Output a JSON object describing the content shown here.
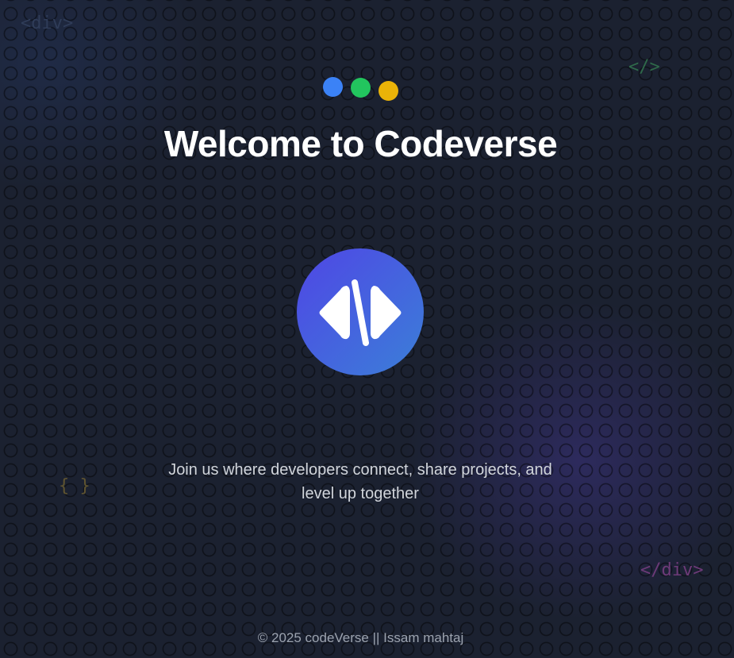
{
  "decorations": {
    "div_open": "<div>",
    "slash_tag": "</>",
    "braces": "{ }",
    "div_close": "</div>"
  },
  "header": {
    "dots": [
      {
        "name": "blue-dot",
        "color": "#3b82f6"
      },
      {
        "name": "green-dot",
        "color": "#22c55e"
      },
      {
        "name": "yellow-dot",
        "color": "#eab308"
      }
    ],
    "title": "Welcome to Codeverse"
  },
  "logo": {
    "icon": "code-brackets-icon",
    "gradient_start": "#4f46e5",
    "gradient_end": "#3b7fd8"
  },
  "tagline": "Join us where developers connect, share projects, and level up together",
  "footer": {
    "text": "© 2025 codeVerse || Issam mahtaj"
  }
}
